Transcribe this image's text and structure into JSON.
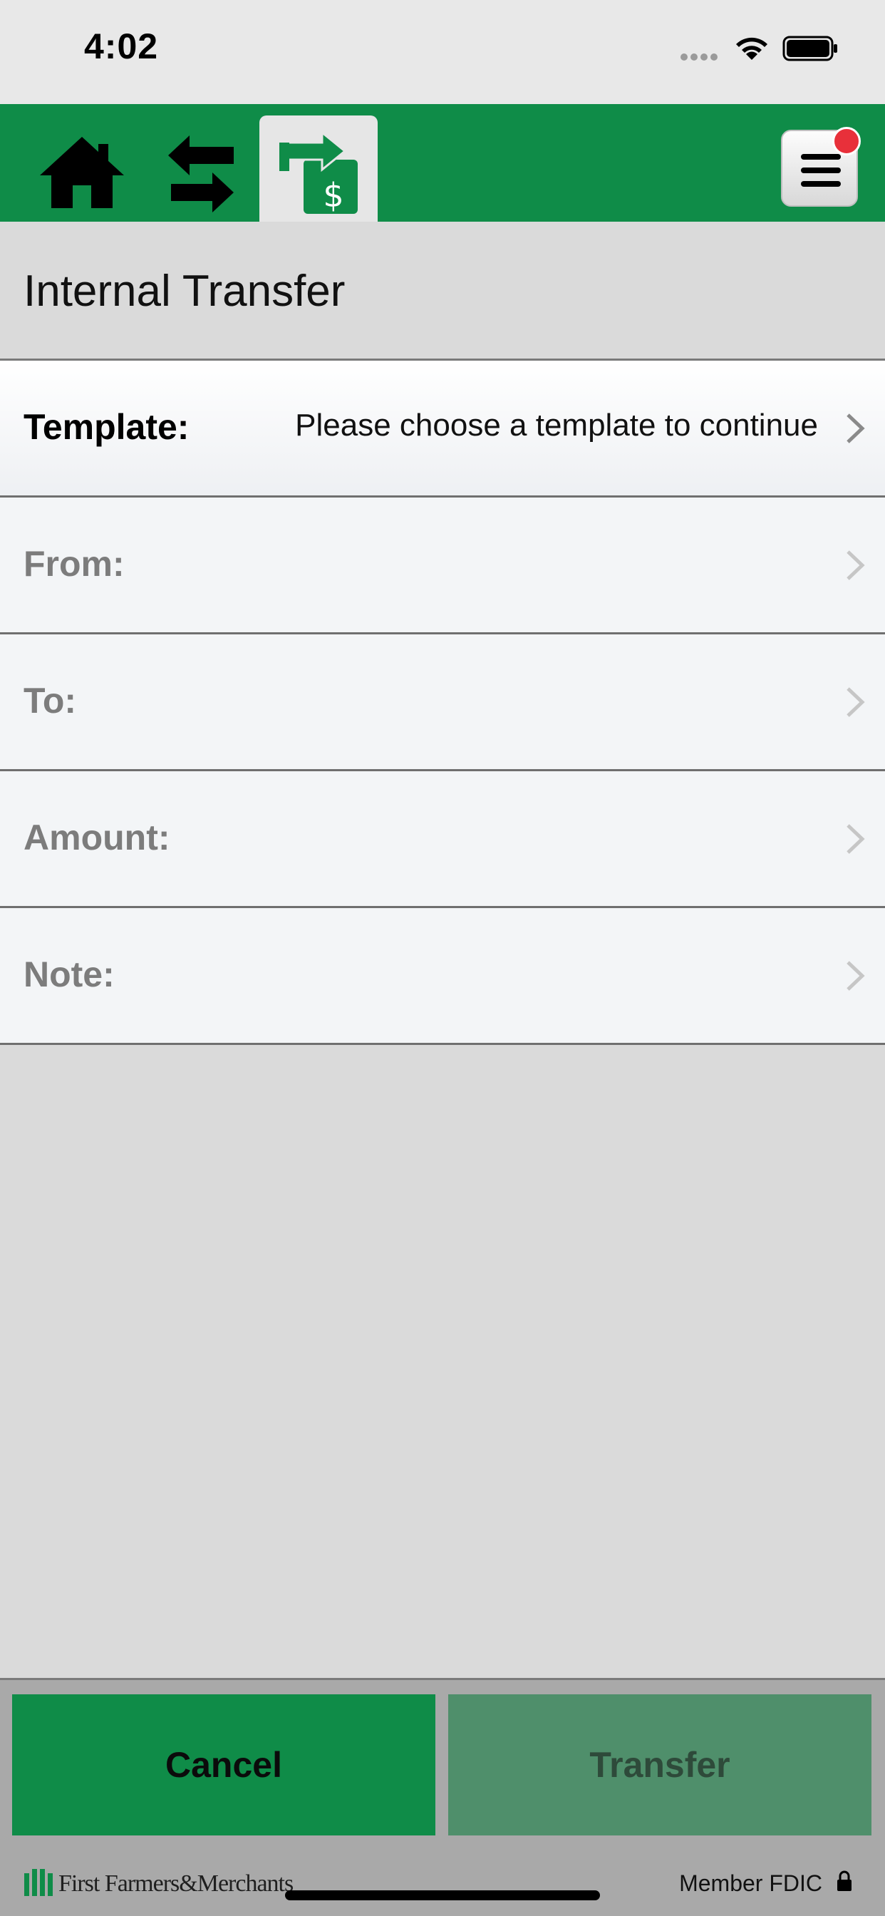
{
  "status_bar": {
    "time": "4:02"
  },
  "nav": {
    "home_icon": "home-icon",
    "swap_icon": "swap-arrows-icon",
    "transfer_icon": "transfer-dollar-icon",
    "menu_icon": "hamburger-menu-icon",
    "accent_color": "#0f8c48",
    "badge_color": "#e8303a"
  },
  "header": {
    "title": "Internal Transfer"
  },
  "form": {
    "rows": [
      {
        "label": "Template:",
        "value": "Please choose a template to continue"
      },
      {
        "label": "From:",
        "value": ""
      },
      {
        "label": "To:",
        "value": ""
      },
      {
        "label": "Amount:",
        "value": ""
      },
      {
        "label": "Note:",
        "value": ""
      }
    ]
  },
  "actions": {
    "cancel_label": "Cancel",
    "transfer_label": "Transfer"
  },
  "footer": {
    "logo_text": "First Farmers&Merchants",
    "fdic_text": "Member FDIC"
  }
}
